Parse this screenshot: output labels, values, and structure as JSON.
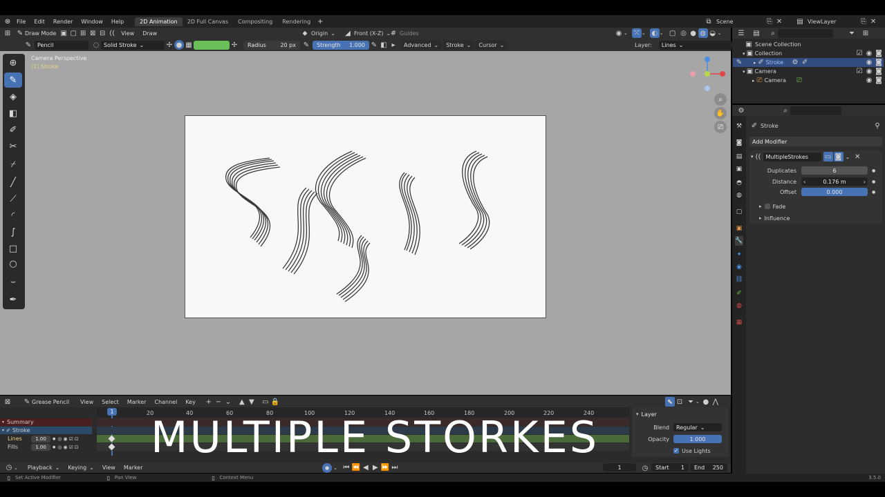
{
  "topbar": {
    "menus": [
      "File",
      "Edit",
      "Render",
      "Window",
      "Help"
    ],
    "workspaces": [
      "2D Animation",
      "2D Full Canvas",
      "Compositing",
      "Rendering"
    ],
    "active_workspace_index": 0,
    "scene": "Scene",
    "view_layer": "ViewLayer"
  },
  "header": {
    "mode": "Draw Mode",
    "view": "View",
    "draw": "Draw",
    "origin": "Origin",
    "orientation": "Front (X-Z)",
    "guides": "Guides"
  },
  "tool_settings": {
    "brush": "Pencil",
    "material": "Solid Stroke",
    "color": "#6abf59",
    "radius_label": "Radius",
    "radius_value": "20 px",
    "strength_label": "Strength",
    "strength_value": "1.000",
    "advanced": "Advanced",
    "stroke": "Stroke",
    "cursor": "Cursor",
    "layer_label": "Layer:",
    "layer_value": "Lines"
  },
  "viewport": {
    "camera_label": "Camera Perspective",
    "object_label": "(1) Stroke",
    "background": "#a6a6a6",
    "canvas_color": "#f8f8f8"
  },
  "outliner": {
    "title": "Scene Collection",
    "collection": "Collection",
    "stroke": "Stroke",
    "camera_obj": "Camera",
    "camera_data": "Camera"
  },
  "properties": {
    "object": "Stroke",
    "add_modifier": "Add Modifier",
    "modifier_name": "MultipleStrokes",
    "duplicates_label": "Duplicates",
    "duplicates_value": "6",
    "distance_label": "Distance",
    "distance_value": "0.176 m",
    "offset_label": "Offset",
    "offset_value": "0.000",
    "fade": "Fade",
    "influence": "Influence"
  },
  "dopesheet": {
    "mode": "Grease Pencil",
    "menus": [
      "View",
      "Select",
      "Marker",
      "Channel",
      "Key"
    ],
    "current_frame": "1",
    "ruler": [
      "20",
      "40",
      "60",
      "80",
      "100",
      "120",
      "140",
      "160",
      "180",
      "200",
      "220",
      "240"
    ],
    "channels": {
      "summary": "Summary",
      "stroke": "Stroke",
      "lines_label": "Lines",
      "lines_value": "1.00",
      "fills_label": "Fills",
      "fills_value": "1.00"
    },
    "layer_panel": {
      "title": "Layer",
      "blend_label": "Blend",
      "blend_value": "Regular",
      "opacity_label": "Opacity",
      "opacity_value": "1.000",
      "use_lights": "Use Lights"
    }
  },
  "overlay_title": "MULTIPLE STORKES",
  "playback": {
    "playback": "Playback",
    "keying": "Keying",
    "view": "View",
    "marker": "Marker",
    "frame": "1",
    "start_label": "Start",
    "start_value": "1",
    "end_label": "End",
    "end_value": "250"
  },
  "statusbar": {
    "hint1": "Set Active Modifier",
    "hint2": "Pan View",
    "hint3": "Context Menu",
    "version": "3.5.0"
  },
  "icons": [
    "blender-icon",
    "pencil-icon",
    "cursor-icon",
    "fill-icon",
    "eraser-icon",
    "tint-icon",
    "cutter-icon",
    "eyedropper-icon",
    "line-icon",
    "polyline-icon",
    "arc-icon",
    "curve-icon",
    "box-icon",
    "circle-icon",
    "interpolate-icon",
    "zoom-icon",
    "hand-icon",
    "camera-icon",
    "eye-icon",
    "render-icon",
    "funnel-icon",
    "search-icon",
    "wrench-icon"
  ]
}
